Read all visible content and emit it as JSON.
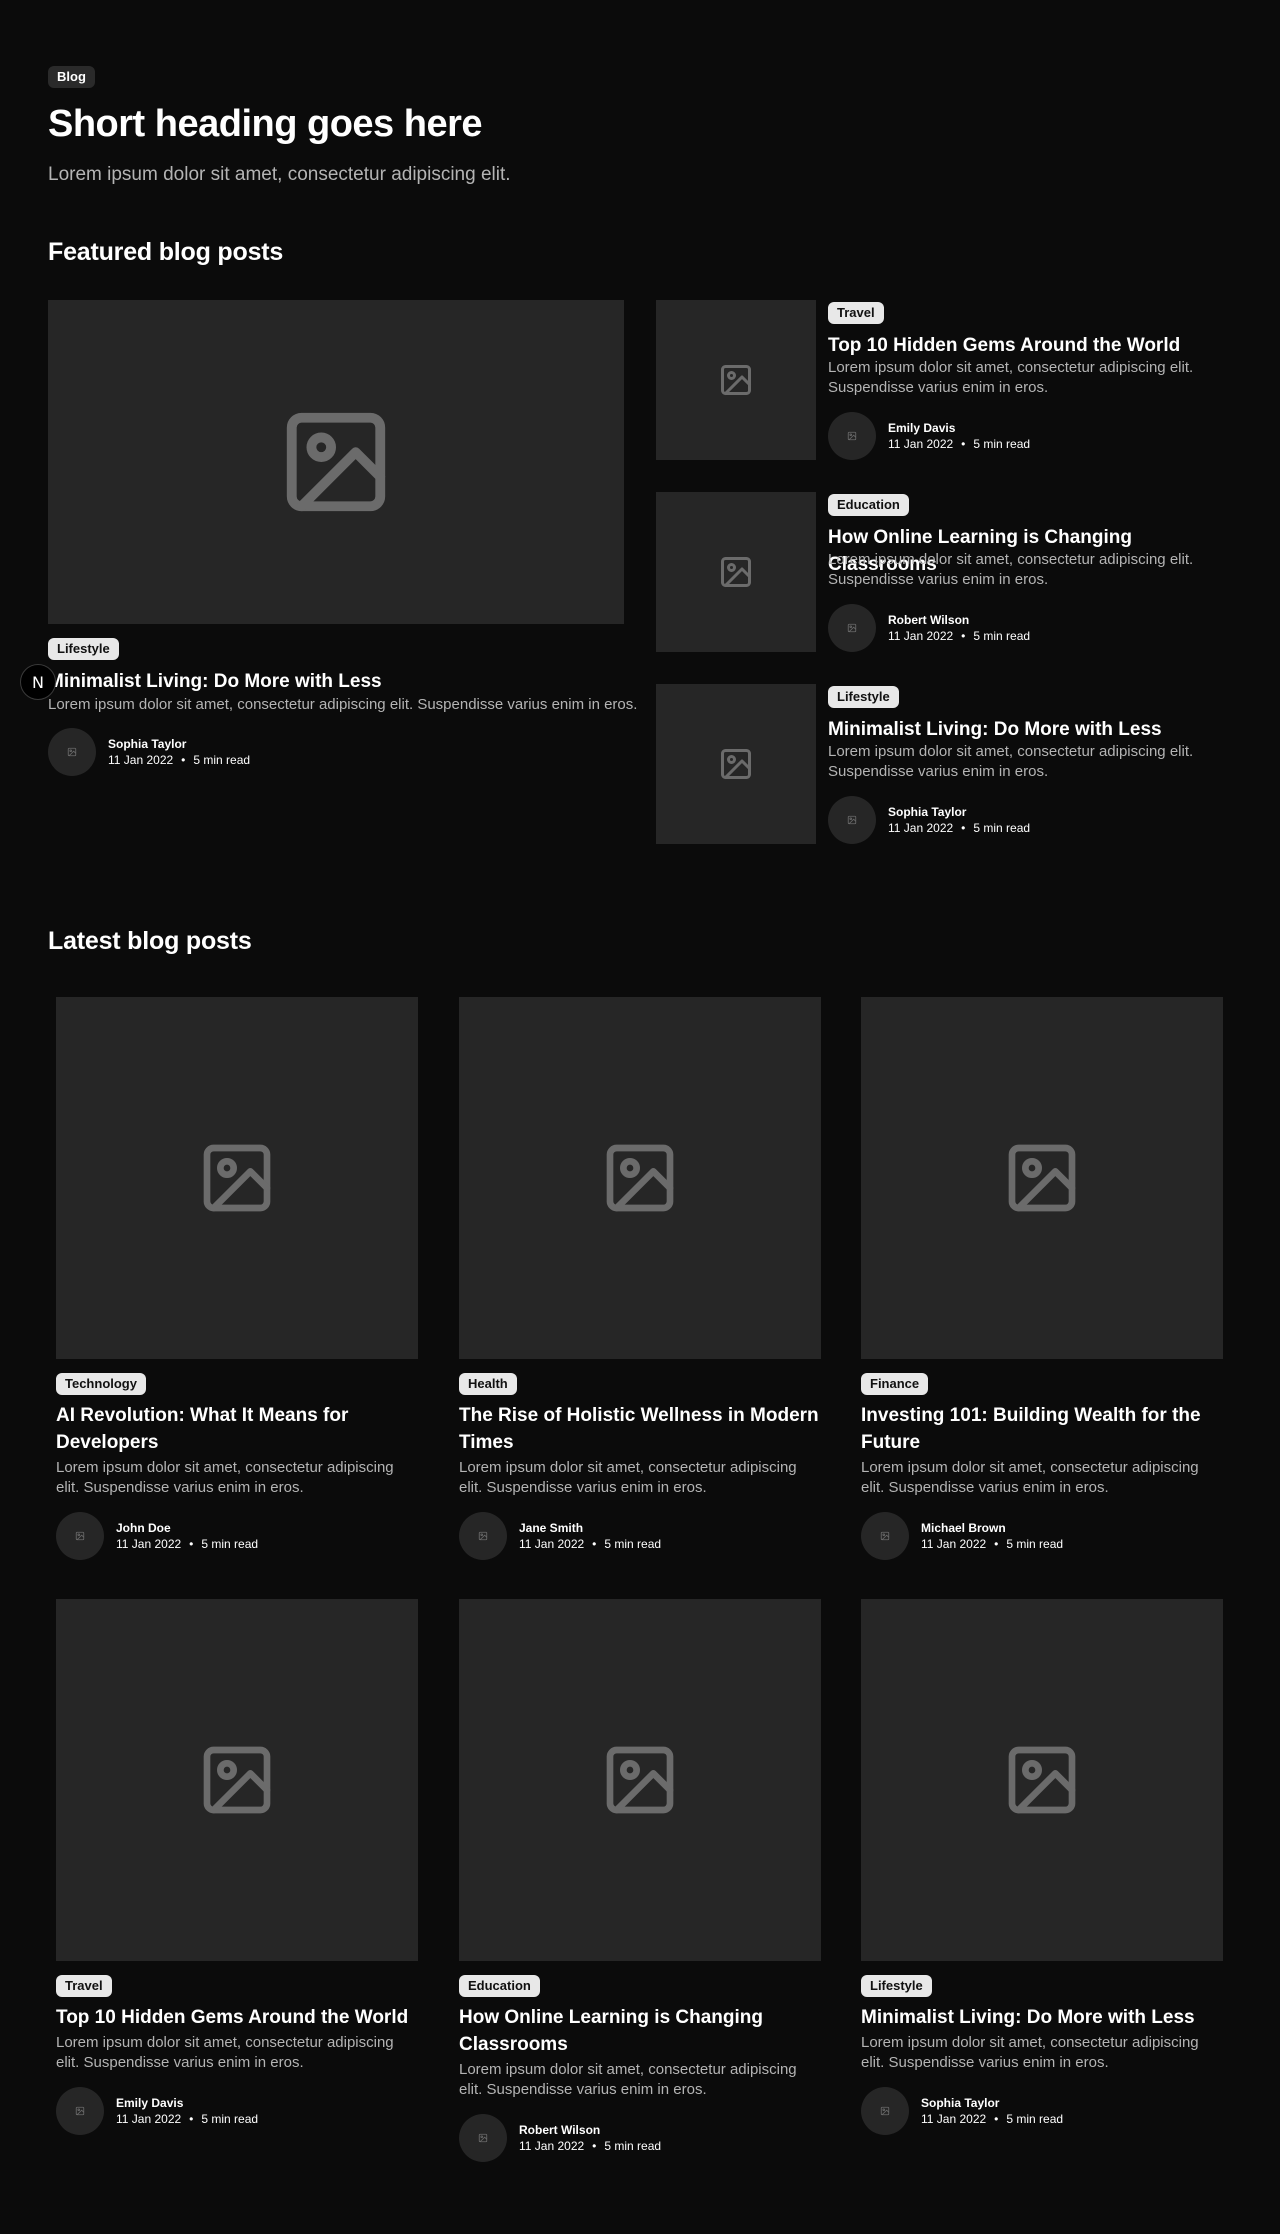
{
  "header": {
    "badge": "Blog",
    "title": "Short heading goes here",
    "subtitle": "Lorem ipsum dolor sit amet, consectetur adipiscing elit."
  },
  "featured": {
    "section_title": "Featured blog posts",
    "main": {
      "category": "Lifestyle",
      "title": "Minimalist Living: Do More with Less",
      "description": "Lorem ipsum dolor sit amet, consectetur adipiscing elit. Suspendisse varius enim in eros.",
      "author": "Sophia Taylor",
      "date": "11 Jan 2022",
      "read_time": "5 min read"
    },
    "side": [
      {
        "category": "Travel",
        "title": "Top 10 Hidden Gems Around the World",
        "description": "Lorem ipsum dolor sit amet, consectetur adipiscing elit. Suspendisse varius enim in eros.",
        "author": "Emily Davis",
        "date": "11 Jan 2022",
        "read_time": "5 min read"
      },
      {
        "category": "Education",
        "title": "How Online Learning is Changing Classrooms",
        "description": "Lorem ipsum dolor sit amet, consectetur adipiscing elit. Suspendisse varius enim in eros.",
        "author": "Robert Wilson",
        "date": "11 Jan 2022",
        "read_time": "5 min read"
      },
      {
        "category": "Lifestyle",
        "title": "Minimalist Living: Do More with Less",
        "description": "Lorem ipsum dolor sit amet, consectetur adipiscing elit. Suspendisse varius enim in eros.",
        "author": "Sophia Taylor",
        "date": "11 Jan 2022",
        "read_time": "5 min read"
      }
    ]
  },
  "latest": {
    "section_title": "Latest blog posts",
    "posts": [
      {
        "category": "Technology",
        "title": "AI Revolution: What It Means for Developers",
        "description": "Lorem ipsum dolor sit amet, consectetur adipiscing elit. Suspendisse varius enim in eros.",
        "author": "John Doe",
        "date": "11 Jan 2022",
        "read_time": "5 min read"
      },
      {
        "category": "Health",
        "title": "The Rise of Holistic Wellness in Modern Times",
        "description": "Lorem ipsum dolor sit amet, consectetur adipiscing elit. Suspendisse varius enim in eros.",
        "author": "Jane Smith",
        "date": "11 Jan 2022",
        "read_time": "5 min read"
      },
      {
        "category": "Finance",
        "title": "Investing 101: Building Wealth for the Future",
        "description": "Lorem ipsum dolor sit amet, consectetur adipiscing elit. Suspendisse varius enim in eros.",
        "author": "Michael Brown",
        "date": "11 Jan 2022",
        "read_time": "5 min read"
      },
      {
        "category": "Travel",
        "title": "Top 10 Hidden Gems Around the World",
        "description": "Lorem ipsum dolor sit amet, consectetur adipiscing elit. Suspendisse varius enim in eros.",
        "author": "Emily Davis",
        "date": "11 Jan 2022",
        "read_time": "5 min read"
      },
      {
        "category": "Education",
        "title": "How Online Learning is Changing Classrooms",
        "description": "Lorem ipsum dolor sit amet, consectetur adipiscing elit. Suspendisse varius enim in eros.",
        "author": "Robert Wilson",
        "date": "11 Jan 2022",
        "read_time": "5 min read"
      },
      {
        "category": "Lifestyle",
        "title": "Minimalist Living: Do More with Less",
        "description": "Lorem ipsum dolor sit amet, consectetur adipiscing elit. Suspendisse varius enim in eros.",
        "author": "Sophia Taylor",
        "date": "11 Jan 2022",
        "read_time": "5 min read"
      }
    ]
  },
  "dev_indicator": {
    "label": "N"
  },
  "colors": {
    "background": "#0b0b0b",
    "image_placeholder": "#262626",
    "icon": "#6b6b6b",
    "muted_text": "#b4b4b4"
  }
}
